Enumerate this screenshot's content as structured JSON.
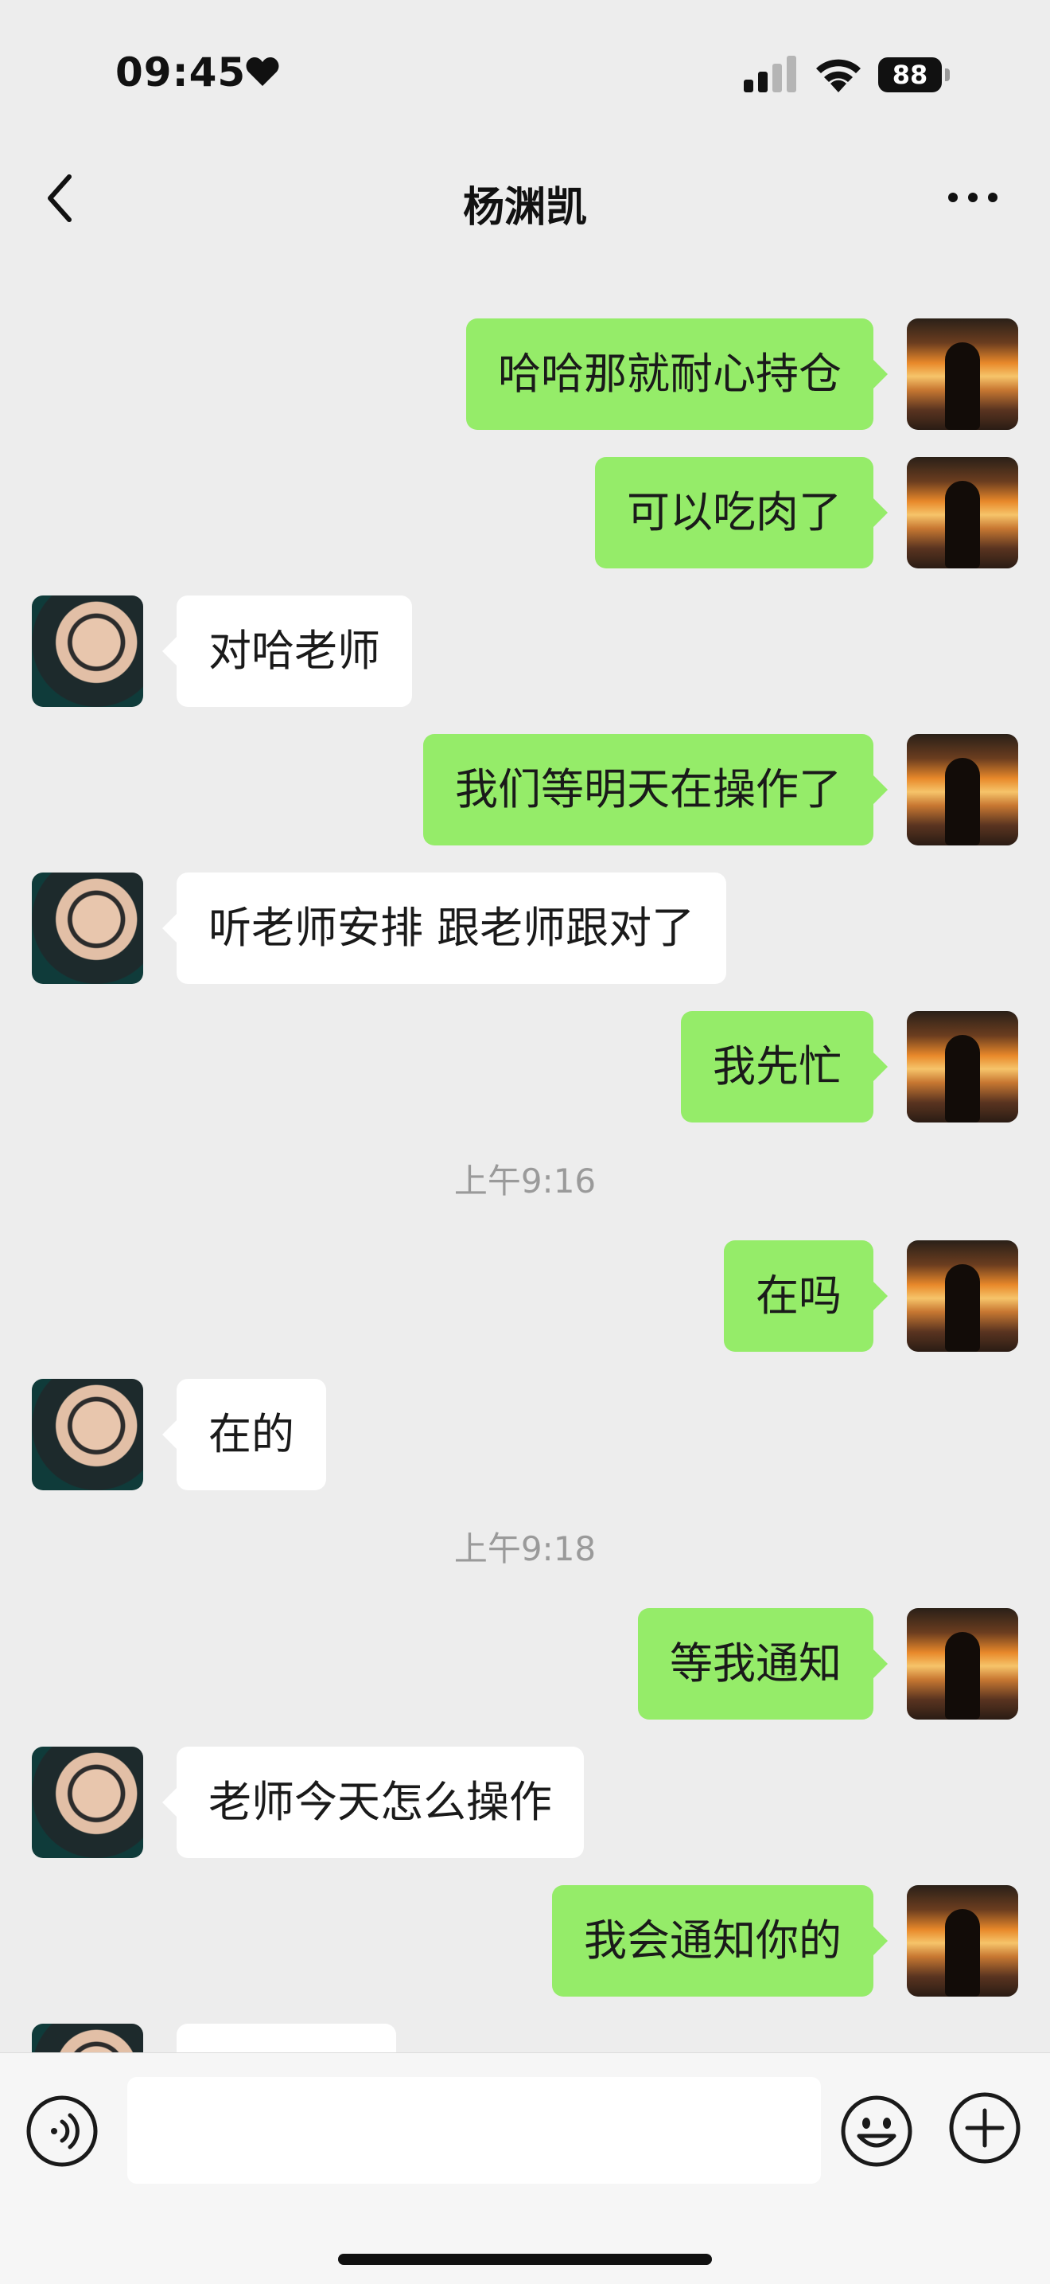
{
  "status_bar": {
    "time": "09:45",
    "battery": "88"
  },
  "header": {
    "title": "杨渊凯"
  },
  "messages": [
    {
      "sender": "other",
      "text": ""
    },
    {
      "sender": "self",
      "text": "哈哈那就耐心持仓"
    },
    {
      "sender": "self",
      "text": "可以吃肉了"
    },
    {
      "sender": "other",
      "text": "对哈老师"
    },
    {
      "sender": "self",
      "text": "我们等明天在操作了"
    },
    {
      "sender": "other",
      "text": "听老师安排 跟老师跟对了"
    },
    {
      "sender": "self",
      "text": "我先忙"
    },
    {
      "time": "上午9:16"
    },
    {
      "sender": "self",
      "text": "在吗"
    },
    {
      "sender": "other",
      "text": "在的"
    },
    {
      "time": "上午9:18"
    },
    {
      "sender": "self",
      "text": "等我通知"
    },
    {
      "sender": "other",
      "text": "老师今天怎么操作"
    },
    {
      "sender": "self",
      "text": "我会通知你的"
    },
    {
      "sender": "other",
      "text": ""
    }
  ],
  "input": {
    "value": ""
  },
  "icons": {
    "back": "chevron-left-icon",
    "more": "ellipsis-icon",
    "voice": "voice-icon",
    "emoji": "emoji-icon",
    "plus": "plus-icon",
    "heart": "heart-icon",
    "signal": "cellular-signal-icon",
    "wifi": "wifi-icon"
  },
  "colors": {
    "background": "#ededed",
    "self_bubble": "#95ec69",
    "other_bubble": "#ffffff",
    "timestamp": "#9a9a9a"
  }
}
